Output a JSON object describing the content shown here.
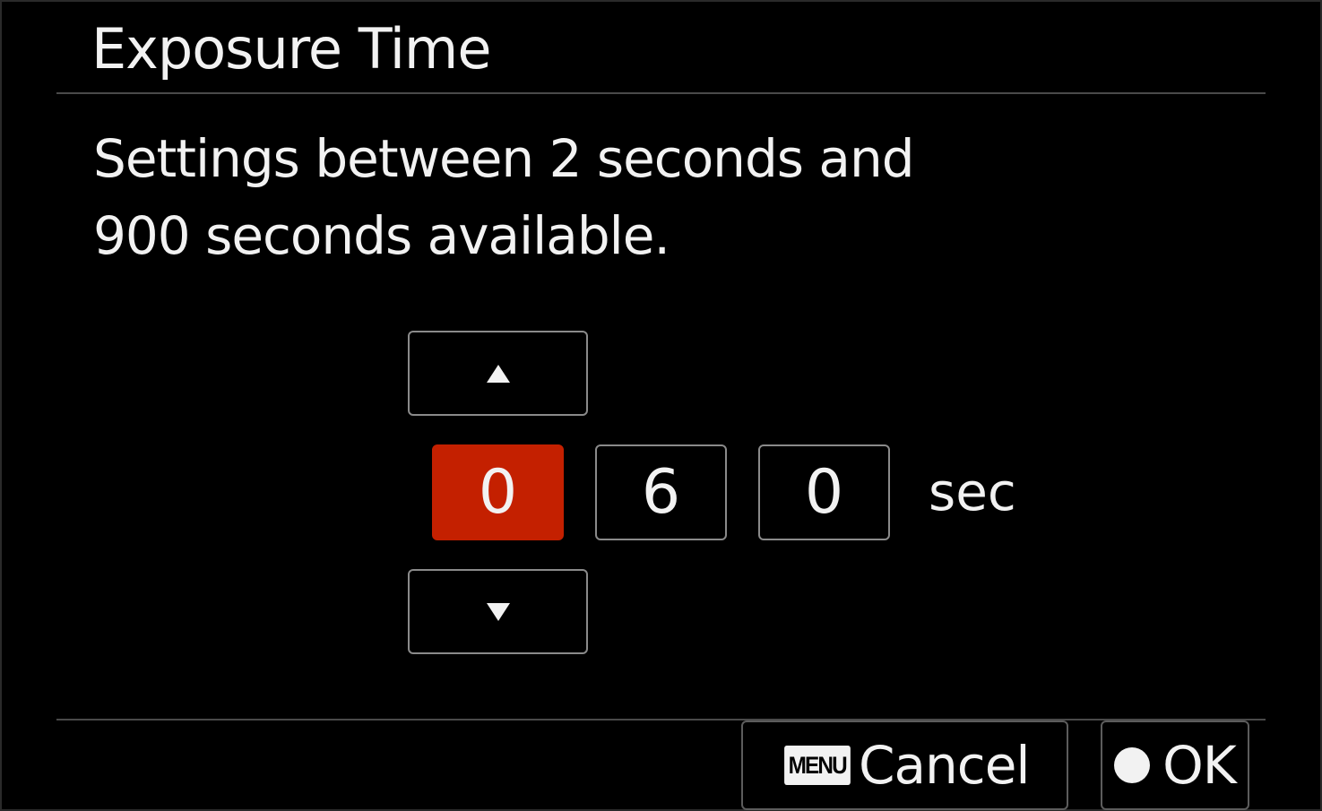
{
  "dialog": {
    "title": "Exposure Time",
    "description_line1": "Settings between 2 seconds and",
    "description_line2": "900 seconds available."
  },
  "exposure": {
    "digits": [
      "0",
      "6",
      "0"
    ],
    "selected_digit_index": 0,
    "unit": "sec"
  },
  "footer": {
    "cancel_key": "MENU",
    "cancel_label": "Cancel",
    "ok_label": "OK"
  },
  "icons": {
    "increment": "triangle-up-icon",
    "decrement": "triangle-down-icon",
    "menu_key": "menu-key-icon",
    "ok_key": "filled-circle-icon"
  },
  "colors": {
    "background": "#000000",
    "text": "#f2f2f2",
    "selected_digit": "#c42000",
    "border": "#8a8a8a"
  }
}
